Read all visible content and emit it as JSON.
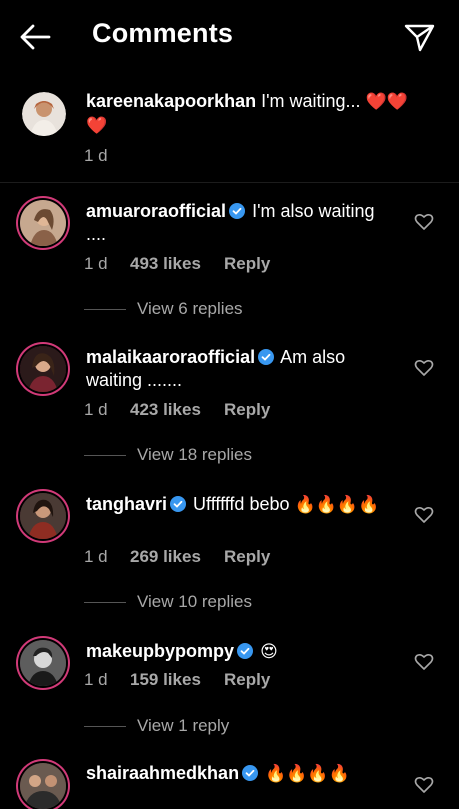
{
  "header": {
    "title": "Comments"
  },
  "caption": {
    "username": "kareenakapoorkhan",
    "text": "I'm waiting...",
    "emoji": "❤️❤️❤️",
    "time": "1 d"
  },
  "comments": [
    {
      "username": "amuarora official",
      "user": "amuaroraofficial",
      "text": "I'm also waiting ....",
      "time": "1 d",
      "likes": "493 likes",
      "reply": "Reply",
      "view_replies": "View 6 replies"
    },
    {
      "user": "malaikaaroraofficial",
      "text": "Am also waiting .......",
      "time": "1 d",
      "likes": "423 likes",
      "reply": "Reply",
      "view_replies": "View 18 replies"
    },
    {
      "user": "tanghavri",
      "text": "Uffffffd bebo",
      "emoji": "🔥🔥🔥🔥",
      "time": "1 d",
      "likes": "269 likes",
      "reply": "Reply",
      "view_replies": "View 10 replies"
    },
    {
      "user": "makeupbypompy",
      "emoji": "😍",
      "time": "1 d",
      "likes": "159 likes",
      "reply": "Reply",
      "view_replies": "View 1 reply"
    },
    {
      "user": "shairaahmedkhan",
      "emoji": "🔥🔥🔥🔥"
    }
  ],
  "colors": {
    "ring": "#d13a78",
    "verified": "#3897f0",
    "meta": "#a8a8a8"
  },
  "icons": [
    "back-arrow-icon",
    "send-icon",
    "verified-badge-icon",
    "heart-outline-icon"
  ]
}
